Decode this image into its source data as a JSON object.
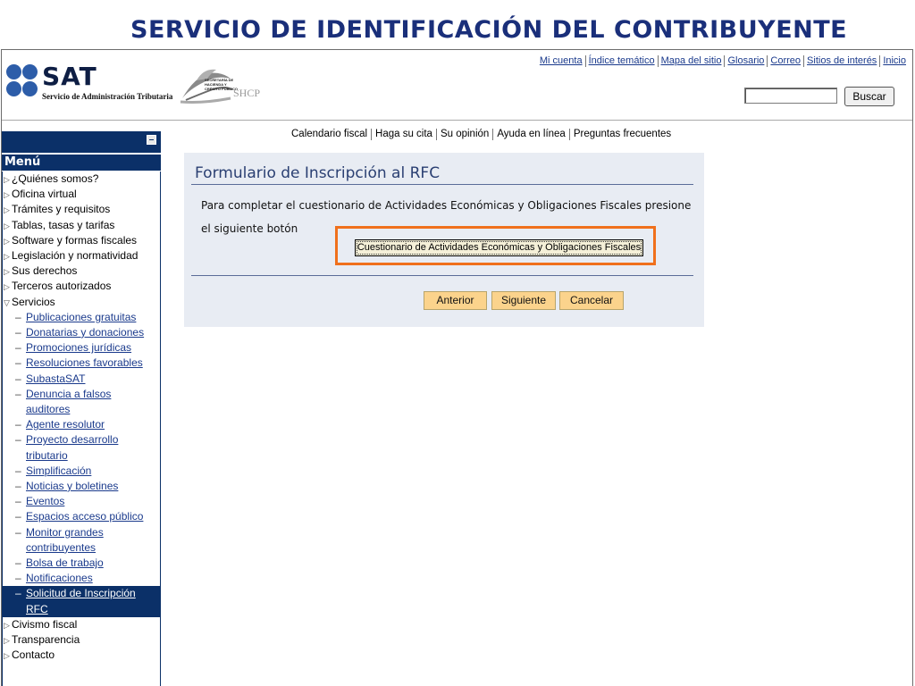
{
  "slide_title": "SERVICIO DE IDENTIFICACIÓN DEL CONTRIBUYENTE",
  "header": {
    "logo_text": "SAT",
    "logo_subtitle": "Servicio de Administración Tributaria",
    "shcp_lines": [
      "SECRETARÍA DE",
      "HACIENDA Y",
      "CRÉDITO PÚBLICO"
    ],
    "shcp_abbr": "SHCP",
    "top_links": [
      "Mi cuenta",
      "Índice temático",
      "Mapa del sitio",
      "Glosario",
      "Correo",
      "Sitios de interés",
      "Inicio"
    ],
    "search_value": "",
    "search_button": "Buscar"
  },
  "toolbar_links": [
    "Calendario fiscal",
    "Haga su cita",
    "Su opinión",
    "Ayuda en línea",
    "Preguntas frecuentes"
  ],
  "sidebar": {
    "menu_title": "Menú",
    "items_top": [
      "¿Quiénes somos?",
      "Oficina virtual",
      "Trámites y requisitos",
      "Tablas, tasas y tarifas",
      "Software y formas fiscales",
      "Legislación y normatividad",
      "Sus derechos",
      "Terceros autorizados"
    ],
    "servicios_label": "Servicios",
    "sub_items": [
      [
        "Publicaciones gratuitas"
      ],
      [
        "Donatarias y donaciones"
      ],
      [
        "Promociones jurídicas"
      ],
      [
        "Resoluciones favorables"
      ],
      [
        "SubastaSAT"
      ],
      [
        "Denuncia a falsos",
        "auditores"
      ],
      [
        "Agente resolutor"
      ],
      [
        "Proyecto desarrollo",
        "tributario"
      ],
      [
        "Simplificación"
      ],
      [
        "Noticias y boletines"
      ],
      [
        "Eventos"
      ],
      [
        "Espacios acceso público"
      ],
      [
        "Monitor grandes",
        "contribuyentes"
      ],
      [
        "Bolsa de trabajo"
      ],
      [
        "Notificaciones"
      ],
      [
        "Solicitud de Inscripción",
        "RFC"
      ]
    ],
    "active_sub_index": 15,
    "items_bottom": [
      "Civismo fiscal",
      "Transparencia",
      "Contacto"
    ]
  },
  "form": {
    "title": "Formulario de Inscripción al RFC",
    "instruction": "Para completar el cuestionario de Actividades Económicas y Obligaciones Fiscales presione el siguiente botón",
    "questionnaire_button": "Cuestionario de Actividades Económicas y Obligaciones Fiscales",
    "buttons": {
      "previous": "Anterior",
      "next": "Siguiente",
      "cancel": "Cancelar"
    }
  },
  "colors": {
    "accent_navy": "#0b3068",
    "highlight_orange": "#f0701c",
    "button_yellow": "#fbd38c",
    "panel_bg": "#e8ecf3"
  }
}
